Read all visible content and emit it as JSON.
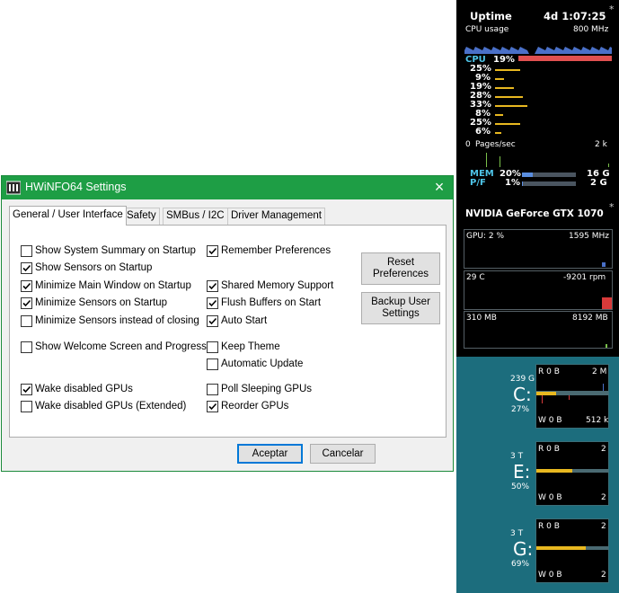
{
  "dialog": {
    "title": "HWiNFO64 Settings",
    "close_label": "×",
    "tabs": [
      {
        "label": "General / User Interface",
        "active": true
      },
      {
        "label": "Safety",
        "active": false
      },
      {
        "label": "SMBus / I2C",
        "active": false
      },
      {
        "label": "Driver Management",
        "active": false
      }
    ],
    "options_left": [
      {
        "label": "Show System Summary on Startup",
        "checked": false
      },
      {
        "label": "Show Sensors on Startup",
        "checked": true
      },
      {
        "label": "Minimize Main Window on Startup",
        "checked": true
      },
      {
        "label": "Minimize Sensors on Startup",
        "checked": true
      },
      {
        "label": "Minimize Sensors instead of closing",
        "checked": false
      },
      {
        "label": "Show Welcome Screen and Progress",
        "checked": false
      },
      {
        "label": "Wake disabled GPUs",
        "checked": true
      },
      {
        "label": "Wake disabled GPUs (Extended)",
        "checked": false
      }
    ],
    "options_right": [
      {
        "label": "Remember Preferences",
        "checked": true
      },
      {
        "label": "Shared Memory Support",
        "checked": true
      },
      {
        "label": "Flush Buffers on Start",
        "checked": true
      },
      {
        "label": "Auto Start",
        "checked": true
      },
      {
        "label": "Keep Theme",
        "checked": false
      },
      {
        "label": "Automatic Update",
        "checked": false
      },
      {
        "label": "Poll Sleeping GPUs",
        "checked": false
      },
      {
        "label": "Reorder GPUs",
        "checked": true
      }
    ],
    "reset_label_1": "Reset",
    "reset_label_2": "Preferences",
    "backup_label_1": "Backup User",
    "backup_label_2": "Settings",
    "ok_label": "Aceptar",
    "cancel_label": "Cancelar"
  },
  "gadget": {
    "uptime_label": "Uptime",
    "uptime_value": "4d 1:07:25",
    "star": "*",
    "cpu_usage_label": "CPU usage",
    "cpu_freq": "800 MHz",
    "cpu_label": "CPU",
    "cpu_total": "19%",
    "cpu_total_frac": 0.19,
    "cores": [
      {
        "value": "25%",
        "frac": 0.25
      },
      {
        "value": "9%",
        "frac": 0.09
      },
      {
        "value": "19%",
        "frac": 0.19
      },
      {
        "value": "28%",
        "frac": 0.28
      },
      {
        "value": "33%",
        "frac": 0.33
      },
      {
        "value": "8%",
        "frac": 0.08
      },
      {
        "value": "25%",
        "frac": 0.25
      },
      {
        "value": "6%",
        "frac": 0.06
      }
    ],
    "pages_min": "0",
    "pages_label": "Pages/sec",
    "pages_max": "2 k",
    "mem_label": "MEM",
    "mem_pct": "20%",
    "mem_frac": 0.2,
    "mem_total": "16 G",
    "pf_label": "P/F",
    "pf_pct": "1%",
    "pf_frac": 0.01,
    "pf_total": "2 G",
    "gpu_name": "NVIDIA GeForce GTX 1070",
    "gpu_load": "GPU: 2 %",
    "gpu_clock": "1595 MHz",
    "gpu_temp": "29 C",
    "gpu_fan": "-9201 rpm",
    "gpu_mem_used": "310 MB",
    "gpu_mem_total": "8192 MB",
    "drives": [
      {
        "letter": "C:",
        "size": "239 G",
        "pct": "27%",
        "frac": 0.27,
        "read": "R 0 B",
        "read_max": "2 M",
        "write": "W 0 B",
        "write_max": "512 k"
      },
      {
        "letter": "E:",
        "size": "3 T",
        "pct": "50%",
        "frac": 0.5,
        "read": "R 0 B",
        "read_max": "2",
        "write": "W 0 B",
        "write_max": "2"
      },
      {
        "letter": "G:",
        "size": "3 T",
        "pct": "69%",
        "frac": 0.69,
        "read": "R 0 B",
        "read_max": "2",
        "write": "W 0 B",
        "write_max": "2"
      }
    ],
    "colors": {
      "accent": "#4ec4e8",
      "bar": "#e8b820",
      "cpu_bar": "#e05050",
      "mem_bar": "#5a8ee0",
      "drive_bg": "#1c6d7d"
    }
  }
}
